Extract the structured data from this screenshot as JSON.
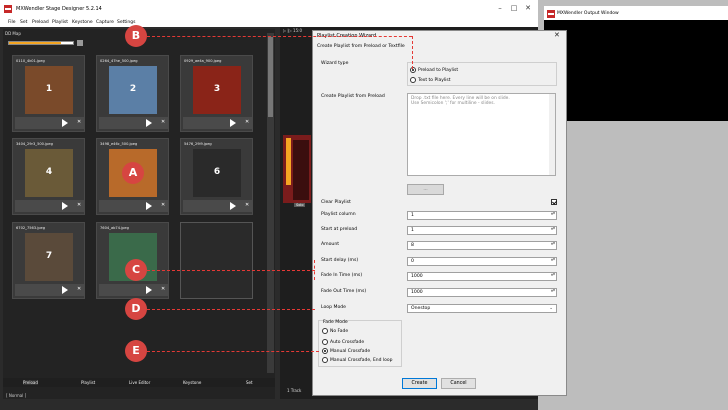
{
  "main_window": {
    "title": "MXWendler Stage Designer 5.2.14",
    "menu": [
      "File",
      "Set",
      "Preload",
      "Playlist",
      "Keystone",
      "Capture",
      "Settings"
    ]
  },
  "preload": {
    "panel_title": "DD Map",
    "progress_fraction": 0.82,
    "tiles": [
      {
        "name": "0110_4k01.jpeg",
        "num": "1",
        "color": "#7a4a2a"
      },
      {
        "name": "0264_47he_500.jpeg",
        "num": "2",
        "color": "#5b7fa6"
      },
      {
        "name": "0929_ae4a_900.jpeg",
        "num": "3",
        "color": "#8a2418"
      },
      {
        "name": "3404_29r3_500.jpeg",
        "num": "4",
        "color": "#6a5a38"
      },
      {
        "name": "3498_e46c_500.jpeg",
        "num": "A",
        "color": "#b86a2a"
      },
      {
        "name": "5476_29l9.jpeg",
        "num": "6",
        "color": "#2a2a2a"
      },
      {
        "name": "6702_7563.jpeg",
        "num": "7",
        "color": "#5a4a3a"
      },
      {
        "name": "7604_ab74.jpeg",
        "num": "",
        "color": "#3a6a4a"
      }
    ]
  },
  "bottom_tabs": [
    "Preload",
    "Playlist",
    "Live Editor",
    "Keystone",
    "Set"
  ],
  "status": "[ Normal ]",
  "middle": {
    "toolbar": "▷ |▷ 15:0",
    "side_label": "Solo",
    "track_label": "1 Track"
  },
  "output_window": {
    "title": "MXWendler Output Window"
  },
  "wizard": {
    "title": "Playlist Creation Wizard",
    "close": "✕",
    "subtitle": "Create Playlist from Preload or Textfile",
    "wizard_type_label": "Wizard type",
    "radio_preload": "Preload to Playlist",
    "radio_text": "Text to Playlist",
    "create_from_preload_label": "Create Playlist from Preload",
    "textarea_placeholder": "Drop .txt file here. Every line will be on slide.\nUse Semicolon ';' for multiline - slides.",
    "browse_label": "...",
    "clear_playlist_label": "Clear Playlist",
    "fields": [
      {
        "label": "Playlist column",
        "value": "1"
      },
      {
        "label": "Start at preload",
        "value": "1"
      },
      {
        "label": "Amount",
        "value": "8"
      },
      {
        "label": "Start delay (ms)",
        "value": "0"
      },
      {
        "label": "Fade In Time (ms)",
        "value": "1000"
      },
      {
        "label": "Fade Out Time (ms)",
        "value": "1000"
      }
    ],
    "loop_mode_label": "Loop Mode",
    "loop_mode_value": "Onestop",
    "fade_mode_label": "Fade Mode",
    "fade_options": [
      "No Fade",
      "Auto Crossfade",
      "Manual Crossfade",
      "Manual Crossfade, End loop"
    ],
    "fade_selected": 2,
    "create_label": "Create",
    "cancel_label": "Cancel"
  },
  "markers": [
    "B",
    "A",
    "C",
    "D",
    "E"
  ]
}
